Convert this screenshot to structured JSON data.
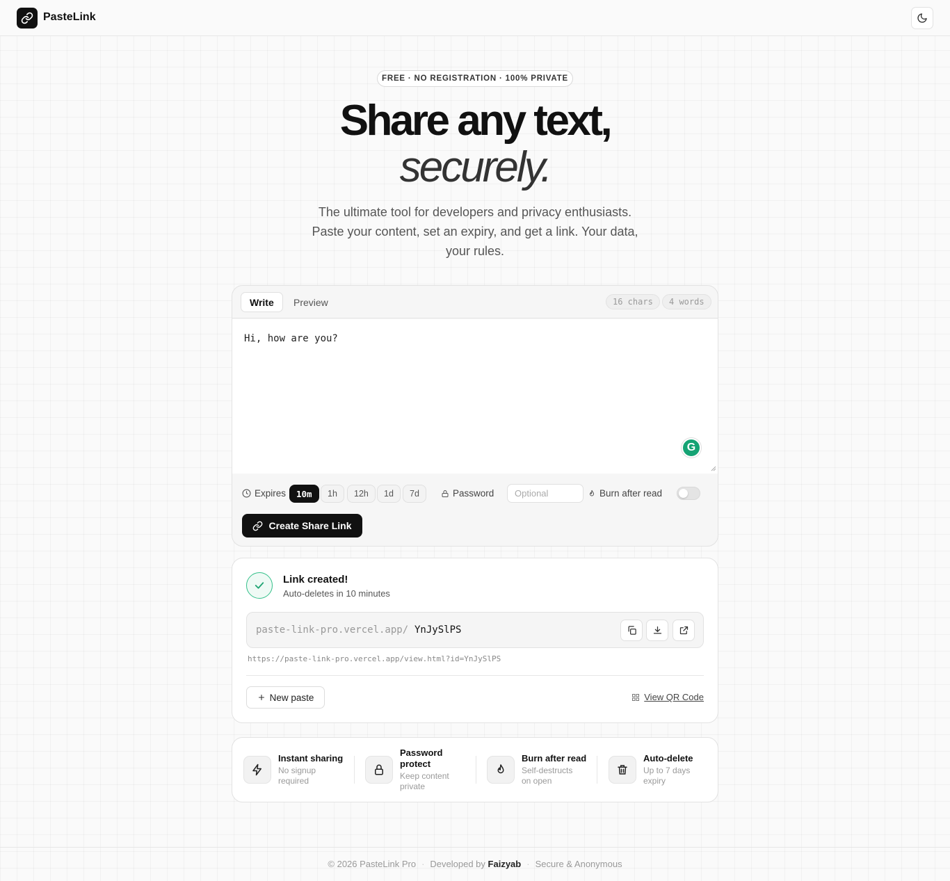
{
  "header": {
    "brand": "PasteLink"
  },
  "hero": {
    "badge": "FREE · NO REGISTRATION · 100% PRIVATE",
    "title_line1": "Share any text,",
    "title_line2": "securely.",
    "subtitle": "The ultimate tool for developers and privacy enthusiasts. Paste your content, set an expiry, and get a link. Your data, your rules."
  },
  "editor": {
    "tabs": [
      {
        "label": "Write",
        "active": true
      },
      {
        "label": "Preview",
        "active": false
      }
    ],
    "char_count": "16 chars",
    "word_count": "4 words",
    "content": "Hi, how are you?",
    "expires_label": "Expires",
    "expiry_options": [
      "10m",
      "1h",
      "12h",
      "1d",
      "7d"
    ],
    "expiry_selected": "10m",
    "password_label": "Password",
    "password_placeholder": "Optional",
    "burn_label": "Burn after read",
    "burn_enabled": false,
    "create_button": "Create Share Link"
  },
  "result": {
    "title": "Link created!",
    "subtitle": "Auto-deletes in 10 minutes",
    "link_base": "paste-link-pro.vercel.app/",
    "link_id": "YnJySlPS",
    "full_url": "https://paste-link-pro.vercel.app/view.html?id=YnJySlPS",
    "new_paste": "New paste",
    "qr_label": "View QR Code"
  },
  "features": [
    {
      "icon": "bolt-icon",
      "title": "Instant sharing",
      "desc": "No signup required"
    },
    {
      "icon": "lock-icon",
      "title": "Password protect",
      "desc": "Keep content private"
    },
    {
      "icon": "flame-icon",
      "title": "Burn after read",
      "desc": "Self-destructs on open"
    },
    {
      "icon": "trash-icon",
      "title": "Auto-delete",
      "desc": "Up to 7 days expiry"
    }
  ],
  "footer": {
    "copyright": "© 2026 PasteLink Pro",
    "developed_by": "Developed by",
    "author": "Faizyab",
    "tagline": "Secure & Anonymous"
  },
  "colors": {
    "primary": "#111111",
    "success": "#34c08a",
    "grammarly": "#15a374"
  }
}
